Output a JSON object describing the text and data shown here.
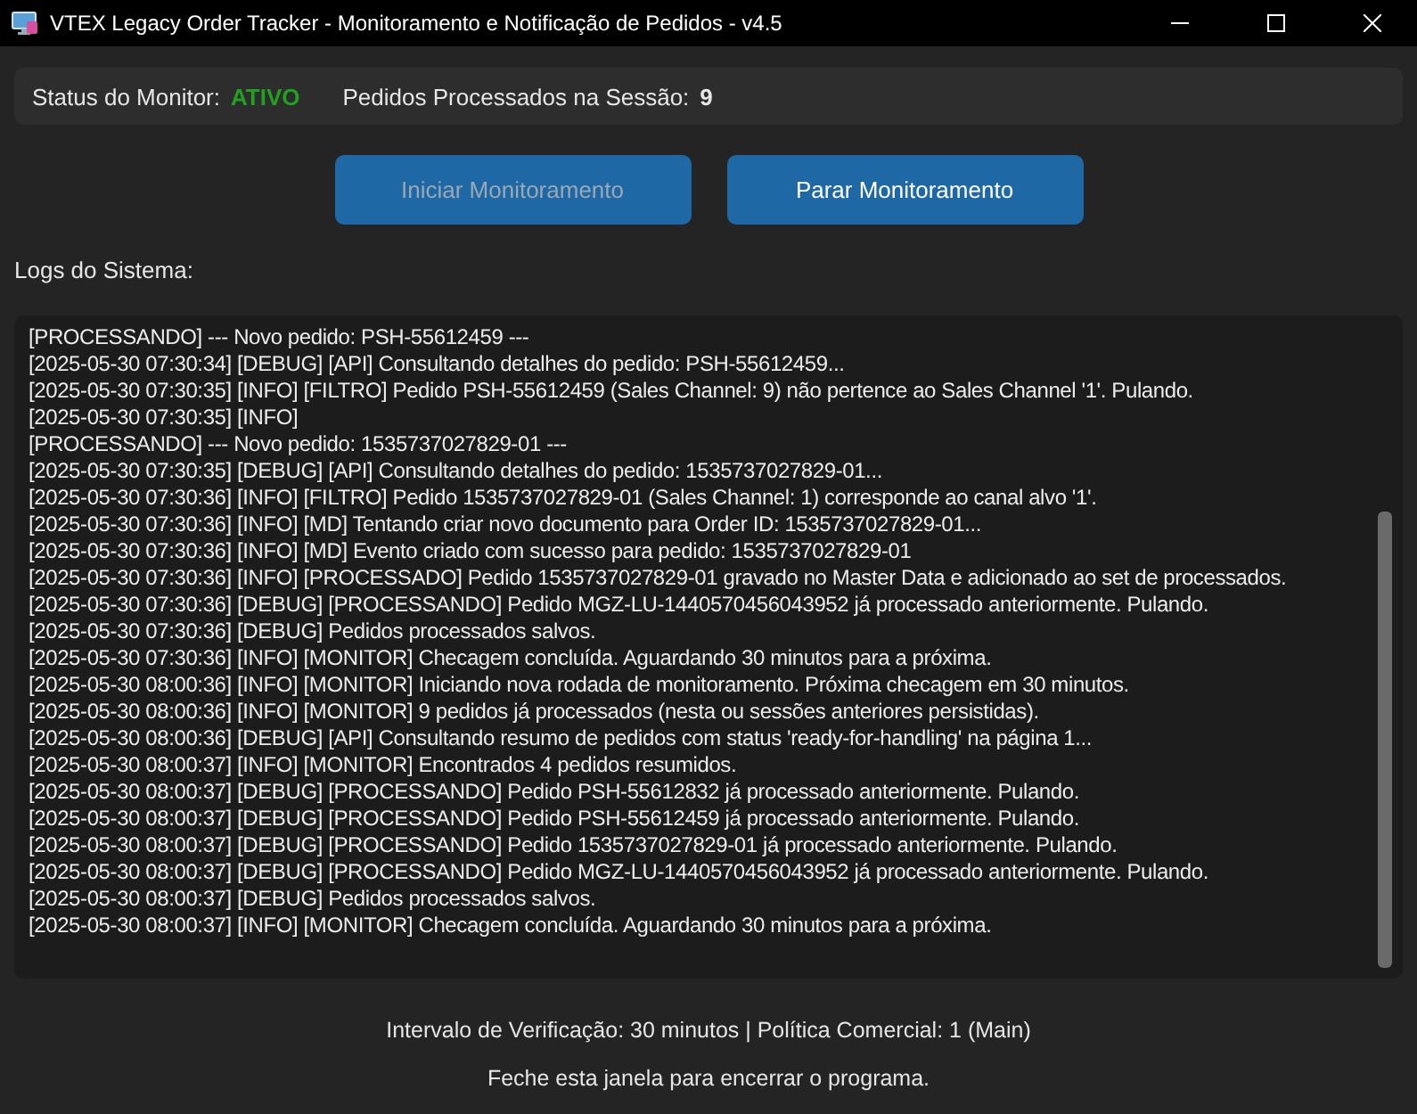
{
  "window": {
    "title": "VTEX Legacy Order Tracker - Monitoramento e Notificação de Pedidos - v4.5"
  },
  "status_bar": {
    "monitor_label": "Status do Monitor:",
    "monitor_value": "ATIVO",
    "processed_label": "Pedidos Processados na Sessão:",
    "processed_value": "9"
  },
  "buttons": [
    {
      "label": "Iniciar Monitoramento",
      "disabled": true
    },
    {
      "label": "Parar Monitoramento",
      "disabled": false
    }
  ],
  "logs": {
    "title": "Logs do Sistema:",
    "lines": [
      "[PROCESSANDO] --- Novo pedido: PSH-55612459 ---",
      "[2025-05-30 07:30:34] [DEBUG] [API] Consultando detalhes do pedido: PSH-55612459...",
      "[2025-05-30 07:30:35] [INFO] [FILTRO] Pedido PSH-55612459 (Sales Channel: 9) não pertence ao Sales Channel '1'. Pulando.",
      "[2025-05-30 07:30:35] [INFO]",
      "[PROCESSANDO] --- Novo pedido: 1535737027829-01 ---",
      "[2025-05-30 07:30:35] [DEBUG] [API] Consultando detalhes do pedido: 1535737027829-01...",
      "[2025-05-30 07:30:36] [INFO] [FILTRO] Pedido 1535737027829-01 (Sales Channel: 1) corresponde ao canal alvo '1'.",
      "[2025-05-30 07:30:36] [INFO] [MD] Tentando criar novo documento para Order ID: 1535737027829-01...",
      "[2025-05-30 07:30:36] [INFO] [MD] Evento criado com sucesso para pedido: 1535737027829-01",
      "[2025-05-30 07:30:36] [INFO] [PROCESSADO] Pedido 1535737027829-01 gravado no Master Data e adicionado ao set de processados.",
      "[2025-05-30 07:30:36] [DEBUG] [PROCESSANDO] Pedido MGZ-LU-1440570456043952 já processado anteriormente. Pulando.",
      "[2025-05-30 07:30:36] [DEBUG] Pedidos processados salvos.",
      "[2025-05-30 07:30:36] [INFO] [MONITOR] Checagem concluída. Aguardando 30 minutos para a próxima.",
      "[2025-05-30 08:00:36] [INFO] [MONITOR] Iniciando nova rodada de monitoramento. Próxima checagem em 30 minutos.",
      "[2025-05-30 08:00:36] [INFO] [MONITOR] 9 pedidos já processados (nesta ou sessões anteriores persistidas).",
      "[2025-05-30 08:00:36] [DEBUG] [API] Consultando resumo de pedidos com status 'ready-for-handling' na página 1...",
      "[2025-05-30 08:00:37] [INFO] [MONITOR] Encontrados 4 pedidos resumidos.",
      "[2025-05-30 08:00:37] [DEBUG] [PROCESSANDO] Pedido PSH-55612832 já processado anteriormente. Pulando.",
      "[2025-05-30 08:00:37] [DEBUG] [PROCESSANDO] Pedido PSH-55612459 já processado anteriormente. Pulando.",
      "[2025-05-30 08:00:37] [DEBUG] [PROCESSANDO] Pedido 1535737027829-01 já processado anteriormente. Pulando.",
      "[2025-05-30 08:00:37] [DEBUG] [PROCESSANDO] Pedido MGZ-LU-1440570456043952 já processado anteriormente. Pulando.",
      "[2025-05-30 08:00:37] [DEBUG] Pedidos processados salvos.",
      "[2025-05-30 08:00:37] [INFO] [MONITOR] Checagem concluída. Aguardando 30 minutos para a próxima."
    ]
  },
  "footer": [
    "Intervalo de Verificação: 30 minutos | Política Comercial: 1 (Main)",
    "Feche esta janela para encerrar o programa."
  ]
}
